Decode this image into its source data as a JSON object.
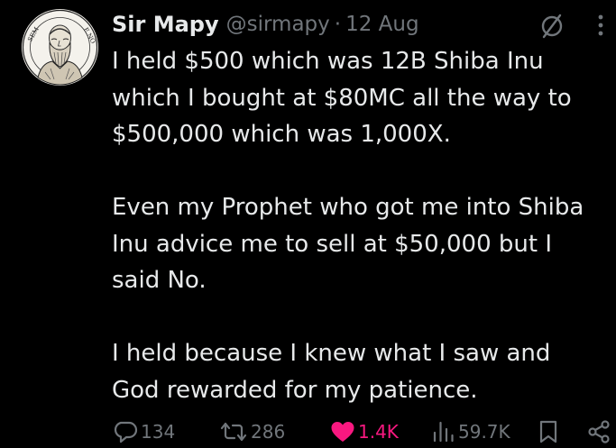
{
  "tweet": {
    "author_name": "Sir Mapy",
    "handle": "@sirmapy",
    "separator": "·",
    "date": "12 Aug",
    "paragraphs": [
      [
        "I held $500 which was 12B Shiba Inu",
        "which I bought at $80MC all the way to",
        "$500,000 which was 1,000X."
      ],
      [
        "Even my Prophet who got me into Shiba",
        "Inu advice me to sell at $50,000 but I",
        "said No."
      ],
      [
        "I held because I knew what I saw and",
        "God rewarded for my patience."
      ]
    ],
    "avatar": {
      "icon": "engraved-portrait-avatar",
      "lettering": [
        "SEM",
        "E.NO"
      ]
    }
  },
  "actions": {
    "replies": "134",
    "reposts": "286",
    "likes": "1.4K",
    "views": "59.7K"
  },
  "colors": {
    "background": "#000000",
    "text": "#e7e9ea",
    "muted": "#71767b",
    "like": "#f91880"
  },
  "icons": [
    "grok-icon",
    "more-icon",
    "reply-icon",
    "repost-icon",
    "like-icon",
    "views-icon",
    "bookmark-icon",
    "share-icon"
  ]
}
